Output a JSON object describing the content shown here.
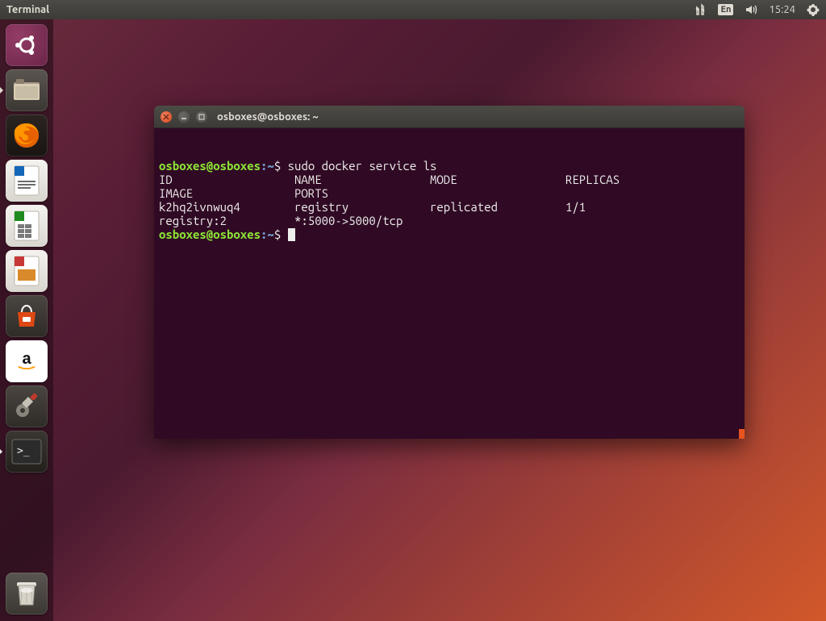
{
  "menubar": {
    "app_title": "Terminal",
    "language": "En",
    "clock": "15:24"
  },
  "launcher": {
    "items": [
      {
        "name": "ubuntu-dash",
        "label": "Dash"
      },
      {
        "name": "files",
        "label": "Files"
      },
      {
        "name": "firefox",
        "label": "Firefox"
      },
      {
        "name": "libreoffice-writer",
        "label": "Writer"
      },
      {
        "name": "libreoffice-calc",
        "label": "Calc"
      },
      {
        "name": "libreoffice-impress",
        "label": "Impress"
      },
      {
        "name": "ubuntu-software",
        "label": "Software"
      },
      {
        "name": "amazon",
        "label": "Amazon"
      },
      {
        "name": "system-settings",
        "label": "Settings"
      },
      {
        "name": "terminal",
        "label": "Terminal"
      },
      {
        "name": "trash",
        "label": "Trash"
      }
    ]
  },
  "terminal": {
    "title": "osboxes@osboxes: ~",
    "prompt_user": "osboxes@osboxes",
    "prompt_sep": ":",
    "prompt_path": "~",
    "prompt_sym": "$",
    "lines": [
      {
        "type": "cmd",
        "text": "sudo docker service ls"
      },
      {
        "type": "out",
        "text": "ID                  NAME                MODE                REPLICAS            IMAGE               PORTS"
      },
      {
        "type": "out",
        "text": "k2hq2ivnwuq4        registry            replicated          1/1                 registry:2          *:5000->5000/tcp"
      },
      {
        "type": "cmd",
        "text": ""
      }
    ],
    "cols": 80
  }
}
